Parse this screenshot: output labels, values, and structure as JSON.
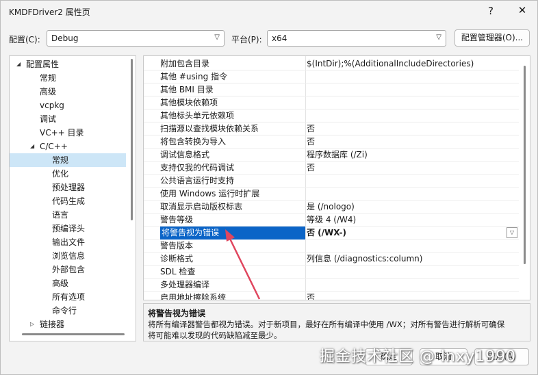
{
  "window": {
    "title": "KMDFDriver2 属性页",
    "help": "?",
    "close": "✕"
  },
  "config": {
    "label": "配置(C):",
    "value": "Debug"
  },
  "platform": {
    "label": "平台(P):",
    "value": "x64"
  },
  "config_manager_label": "配置管理器(O)...",
  "tree": [
    {
      "label": "配置属性",
      "expanded": true
    },
    {
      "label": "常规"
    },
    {
      "label": "高级"
    },
    {
      "label": "vcpkg"
    },
    {
      "label": "调试"
    },
    {
      "label": "VC++ 目录"
    },
    {
      "label": "C/C++",
      "expanded": true
    },
    {
      "label": "常规",
      "selected": true
    },
    {
      "label": "优化"
    },
    {
      "label": "预处理器"
    },
    {
      "label": "代码生成"
    },
    {
      "label": "语言"
    },
    {
      "label": "预编译头"
    },
    {
      "label": "输出文件"
    },
    {
      "label": "浏览信息"
    },
    {
      "label": "外部包含"
    },
    {
      "label": "高级"
    },
    {
      "label": "所有选项"
    },
    {
      "label": "命令行"
    },
    {
      "label": "链接器",
      "expanded": false
    }
  ],
  "properties": [
    {
      "name": "附加包含目录",
      "value": "$(IntDir);%(AdditionalIncludeDirectories)"
    },
    {
      "name": "其他 #using 指令",
      "value": ""
    },
    {
      "name": "其他 BMI 目录",
      "value": ""
    },
    {
      "name": "其他模块依赖项",
      "value": ""
    },
    {
      "name": "其他标头单元依赖项",
      "value": ""
    },
    {
      "name": "扫描源以查找模块依赖关系",
      "value": "否"
    },
    {
      "name": "将包含转换为导入",
      "value": "否"
    },
    {
      "name": "调试信息格式",
      "value": "程序数据库 (/Zi)"
    },
    {
      "name": "支持仅我的代码调试",
      "value": "否"
    },
    {
      "name": "公共语言运行时支持",
      "value": ""
    },
    {
      "name": "使用 Windows 运行时扩展",
      "value": ""
    },
    {
      "name": "取消显示启动版权标志",
      "value": "是 (/nologo)"
    },
    {
      "name": "警告等级",
      "value": "等级 4 (/W4)"
    },
    {
      "name": "将警告视为错误",
      "value": "否 (/WX-)",
      "selected": true
    },
    {
      "name": "警告版本",
      "value": ""
    },
    {
      "name": "诊断格式",
      "value": "列信息 (/diagnostics:column)"
    },
    {
      "name": "SDL 检查",
      "value": ""
    },
    {
      "name": "多处理器编译",
      "value": ""
    },
    {
      "name": "启用地址擦除系统",
      "value": "否"
    }
  ],
  "description": {
    "title": "将警告视为错误",
    "line1": "将所有编译器警告都视为错误。对于新项目，最好在所有编译中使用 /WX；对所有警告进行解析可确保",
    "line2": "将可能难以发现的代码缺陷减至最少。"
  },
  "buttons": {
    "ok": "确定",
    "cancel": "取消",
    "apply": "应用(A)"
  },
  "watermark": "掘金技术社区 @ lnxy1990",
  "accent_color": "#0b64c7",
  "arrow_color": "#e0465e"
}
